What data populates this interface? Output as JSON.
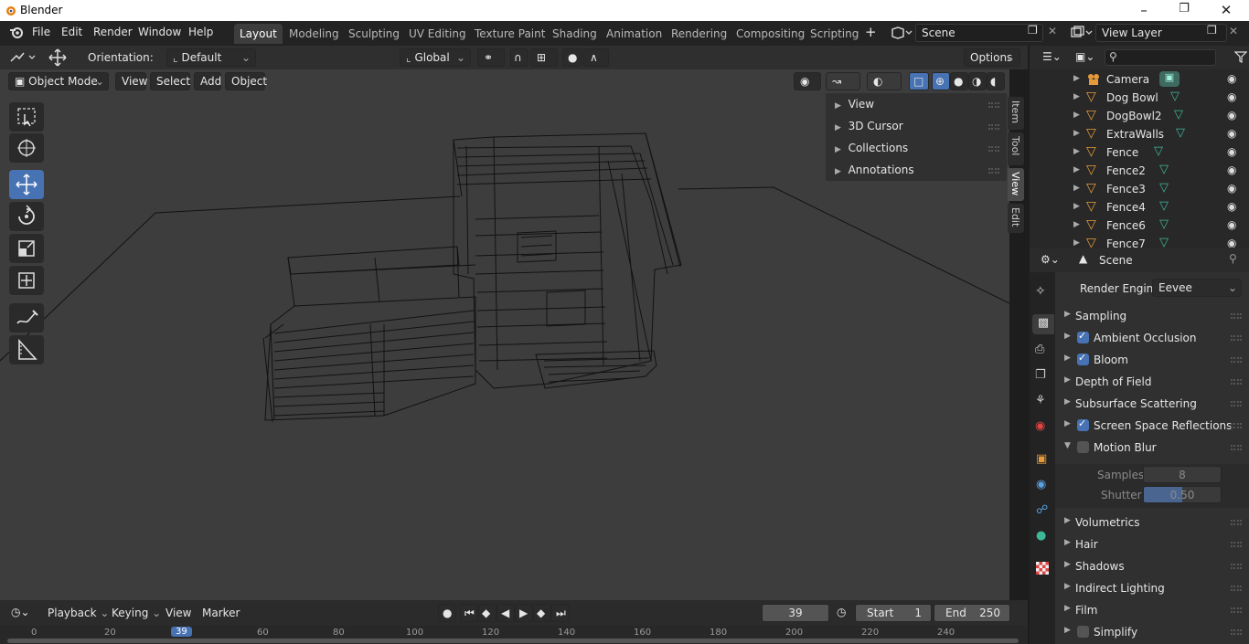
{
  "app": {
    "title": "Blender"
  },
  "menu": [
    "File",
    "Edit",
    "Render",
    "Window",
    "Help"
  ],
  "workspaces": [
    "Layout",
    "Modeling",
    "Sculpting",
    "UV Editing",
    "Texture Paint",
    "Shading",
    "Animation",
    "Rendering",
    "Compositing",
    "Scripting"
  ],
  "active_workspace": "Layout",
  "scene": {
    "name": "Scene",
    "view_layer": "View Layer"
  },
  "viewport_header": {
    "orientation_label": "Orientation:",
    "orientation_value": "Default",
    "transform_space": "Global",
    "options_label": "Options",
    "mode": "Object Mode",
    "menus": [
      "View",
      "Select",
      "Add",
      "Object"
    ]
  },
  "npanel": {
    "sections": [
      "View",
      "3D Cursor",
      "Collections",
      "Annotations"
    ],
    "tabs": [
      "Item",
      "Tool",
      "View",
      "Edit"
    ],
    "active_tab": "View"
  },
  "outliner": {
    "search_placeholder": "",
    "items": [
      "Camera",
      "Dog Bowl",
      "DogBowl2",
      "ExtraWalls",
      "Fence",
      "Fence2",
      "Fence3",
      "Fence4",
      "Fence6",
      "Fence7"
    ]
  },
  "properties": {
    "context": "Scene",
    "render_engine_label": "Render Engine",
    "render_engine_value": "Eevee",
    "panels": [
      {
        "label": "Sampling",
        "checkbox": null,
        "expanded": false
      },
      {
        "label": "Ambient Occlusion",
        "checkbox": true,
        "expanded": false
      },
      {
        "label": "Bloom",
        "checkbox": true,
        "expanded": false
      },
      {
        "label": "Depth of Field",
        "checkbox": null,
        "expanded": false
      },
      {
        "label": "Subsurface Scattering",
        "checkbox": null,
        "expanded": false
      },
      {
        "label": "Screen Space Reflections",
        "checkbox": true,
        "expanded": false
      },
      {
        "label": "Motion Blur",
        "checkbox": false,
        "expanded": true
      },
      {
        "label": "Volumetrics",
        "checkbox": null,
        "expanded": false
      },
      {
        "label": "Hair",
        "checkbox": null,
        "expanded": false
      },
      {
        "label": "Shadows",
        "checkbox": null,
        "expanded": false
      },
      {
        "label": "Indirect Lighting",
        "checkbox": null,
        "expanded": false
      },
      {
        "label": "Film",
        "checkbox": null,
        "expanded": false
      },
      {
        "label": "Simplify",
        "checkbox": false,
        "expanded": false
      }
    ],
    "motion_blur": {
      "samples_label": "Samples",
      "samples": "8",
      "shutter_label": "Shutter",
      "shutter": "0.50",
      "shutter_fraction": 0.5
    }
  },
  "timeline": {
    "menus": [
      "Playback",
      "Keying",
      "View",
      "Marker"
    ],
    "current_frame": "39",
    "start_label": "Start",
    "start": "1",
    "end_label": "End",
    "end": "250",
    "ruler": [
      "0",
      "20",
      "39",
      "60",
      "80",
      "100",
      "120",
      "140",
      "160",
      "180",
      "200",
      "220",
      "240"
    ]
  },
  "colors": {
    "accent": "#4772b3",
    "mesh_icon": "#e59a3a",
    "data_icon": "#3fb89a"
  }
}
